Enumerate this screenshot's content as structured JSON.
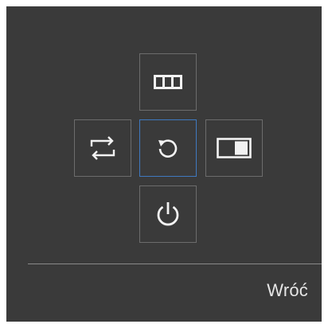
{
  "footer": {
    "back_label": "Wróć"
  },
  "controls": {
    "top": {
      "icon": "picture-mode-icon"
    },
    "left": {
      "icon": "source-switch-icon"
    },
    "center": {
      "icon": "return-icon",
      "selected": true
    },
    "right": {
      "icon": "picture-size-icon"
    },
    "bottom": {
      "icon": "power-icon"
    }
  },
  "colors": {
    "panel_background": "#3a3a3a",
    "button_border": "#6c6c6c",
    "selected_border": "#3f79c0",
    "icon_color": "#f2f2f2",
    "text_color": "#e6e6e6"
  }
}
